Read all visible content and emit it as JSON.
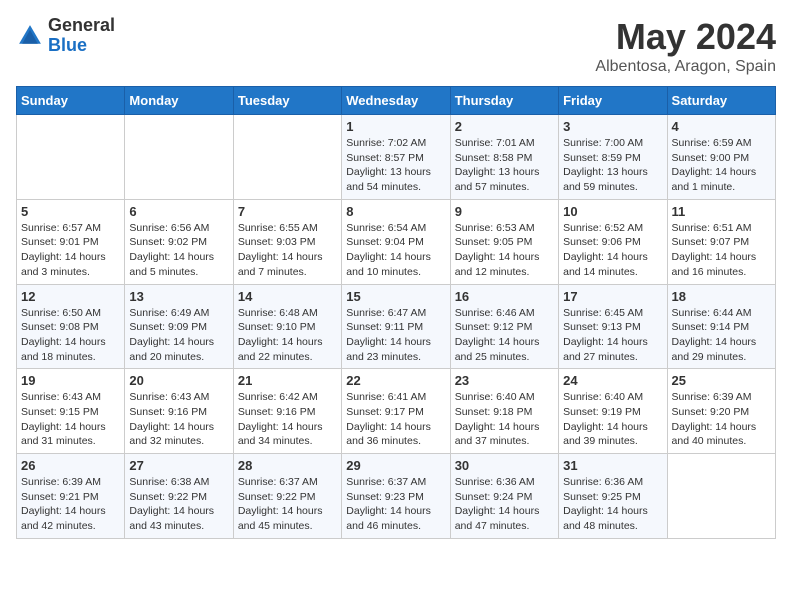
{
  "header": {
    "logo_general": "General",
    "logo_blue": "Blue",
    "month_title": "May 2024",
    "location": "Albentosa, Aragon, Spain"
  },
  "weekdays": [
    "Sunday",
    "Monday",
    "Tuesday",
    "Wednesday",
    "Thursday",
    "Friday",
    "Saturday"
  ],
  "weeks": [
    [
      {
        "day": "",
        "info": ""
      },
      {
        "day": "",
        "info": ""
      },
      {
        "day": "",
        "info": ""
      },
      {
        "day": "1",
        "info": "Sunrise: 7:02 AM\nSunset: 8:57 PM\nDaylight: 13 hours\nand 54 minutes."
      },
      {
        "day": "2",
        "info": "Sunrise: 7:01 AM\nSunset: 8:58 PM\nDaylight: 13 hours\nand 57 minutes."
      },
      {
        "day": "3",
        "info": "Sunrise: 7:00 AM\nSunset: 8:59 PM\nDaylight: 13 hours\nand 59 minutes."
      },
      {
        "day": "4",
        "info": "Sunrise: 6:59 AM\nSunset: 9:00 PM\nDaylight: 14 hours\nand 1 minute."
      }
    ],
    [
      {
        "day": "5",
        "info": "Sunrise: 6:57 AM\nSunset: 9:01 PM\nDaylight: 14 hours\nand 3 minutes."
      },
      {
        "day": "6",
        "info": "Sunrise: 6:56 AM\nSunset: 9:02 PM\nDaylight: 14 hours\nand 5 minutes."
      },
      {
        "day": "7",
        "info": "Sunrise: 6:55 AM\nSunset: 9:03 PM\nDaylight: 14 hours\nand 7 minutes."
      },
      {
        "day": "8",
        "info": "Sunrise: 6:54 AM\nSunset: 9:04 PM\nDaylight: 14 hours\nand 10 minutes."
      },
      {
        "day": "9",
        "info": "Sunrise: 6:53 AM\nSunset: 9:05 PM\nDaylight: 14 hours\nand 12 minutes."
      },
      {
        "day": "10",
        "info": "Sunrise: 6:52 AM\nSunset: 9:06 PM\nDaylight: 14 hours\nand 14 minutes."
      },
      {
        "day": "11",
        "info": "Sunrise: 6:51 AM\nSunset: 9:07 PM\nDaylight: 14 hours\nand 16 minutes."
      }
    ],
    [
      {
        "day": "12",
        "info": "Sunrise: 6:50 AM\nSunset: 9:08 PM\nDaylight: 14 hours\nand 18 minutes."
      },
      {
        "day": "13",
        "info": "Sunrise: 6:49 AM\nSunset: 9:09 PM\nDaylight: 14 hours\nand 20 minutes."
      },
      {
        "day": "14",
        "info": "Sunrise: 6:48 AM\nSunset: 9:10 PM\nDaylight: 14 hours\nand 22 minutes."
      },
      {
        "day": "15",
        "info": "Sunrise: 6:47 AM\nSunset: 9:11 PM\nDaylight: 14 hours\nand 23 minutes."
      },
      {
        "day": "16",
        "info": "Sunrise: 6:46 AM\nSunset: 9:12 PM\nDaylight: 14 hours\nand 25 minutes."
      },
      {
        "day": "17",
        "info": "Sunrise: 6:45 AM\nSunset: 9:13 PM\nDaylight: 14 hours\nand 27 minutes."
      },
      {
        "day": "18",
        "info": "Sunrise: 6:44 AM\nSunset: 9:14 PM\nDaylight: 14 hours\nand 29 minutes."
      }
    ],
    [
      {
        "day": "19",
        "info": "Sunrise: 6:43 AM\nSunset: 9:15 PM\nDaylight: 14 hours\nand 31 minutes."
      },
      {
        "day": "20",
        "info": "Sunrise: 6:43 AM\nSunset: 9:16 PM\nDaylight: 14 hours\nand 32 minutes."
      },
      {
        "day": "21",
        "info": "Sunrise: 6:42 AM\nSunset: 9:16 PM\nDaylight: 14 hours\nand 34 minutes."
      },
      {
        "day": "22",
        "info": "Sunrise: 6:41 AM\nSunset: 9:17 PM\nDaylight: 14 hours\nand 36 minutes."
      },
      {
        "day": "23",
        "info": "Sunrise: 6:40 AM\nSunset: 9:18 PM\nDaylight: 14 hours\nand 37 minutes."
      },
      {
        "day": "24",
        "info": "Sunrise: 6:40 AM\nSunset: 9:19 PM\nDaylight: 14 hours\nand 39 minutes."
      },
      {
        "day": "25",
        "info": "Sunrise: 6:39 AM\nSunset: 9:20 PM\nDaylight: 14 hours\nand 40 minutes."
      }
    ],
    [
      {
        "day": "26",
        "info": "Sunrise: 6:39 AM\nSunset: 9:21 PM\nDaylight: 14 hours\nand 42 minutes."
      },
      {
        "day": "27",
        "info": "Sunrise: 6:38 AM\nSunset: 9:22 PM\nDaylight: 14 hours\nand 43 minutes."
      },
      {
        "day": "28",
        "info": "Sunrise: 6:37 AM\nSunset: 9:22 PM\nDaylight: 14 hours\nand 45 minutes."
      },
      {
        "day": "29",
        "info": "Sunrise: 6:37 AM\nSunset: 9:23 PM\nDaylight: 14 hours\nand 46 minutes."
      },
      {
        "day": "30",
        "info": "Sunrise: 6:36 AM\nSunset: 9:24 PM\nDaylight: 14 hours\nand 47 minutes."
      },
      {
        "day": "31",
        "info": "Sunrise: 6:36 AM\nSunset: 9:25 PM\nDaylight: 14 hours\nand 48 minutes."
      },
      {
        "day": "",
        "info": ""
      }
    ]
  ]
}
